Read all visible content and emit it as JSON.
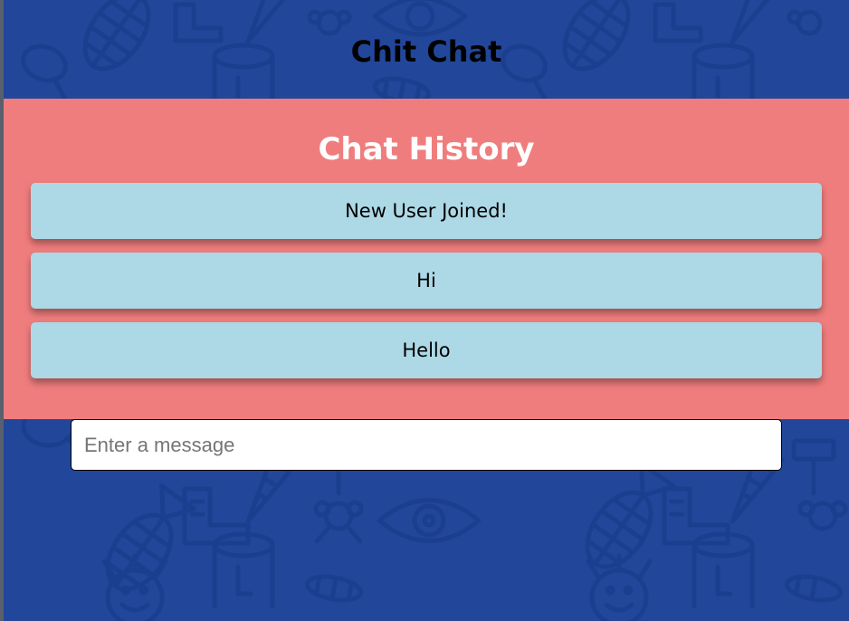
{
  "app": {
    "title": "Chit Chat"
  },
  "chat_history": {
    "title": "Chat History",
    "messages": [
      {
        "text": "New User Joined!"
      },
      {
        "text": "Hi"
      },
      {
        "text": "Hello"
      }
    ]
  },
  "composer": {
    "placeholder": "Enter a message",
    "value": ""
  },
  "colors": {
    "background": "#22479a",
    "doodle": "#1c3f8f",
    "history_panel": "#f07d7d",
    "message_bubble": "#add8e6",
    "history_title": "#ffffff"
  },
  "background_pattern_icons": [
    "fish-icon",
    "boot-icon",
    "eye-icon",
    "hammer-icon",
    "carrot-icon",
    "drumstick-icon",
    "smiley-icon",
    "stump-icon",
    "bee-icon"
  ]
}
